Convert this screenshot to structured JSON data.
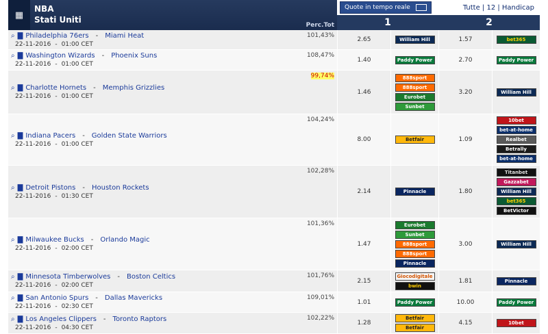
{
  "header": {
    "league": "NBA",
    "country": "Stati Uniti",
    "perc_label": "Perc.Tot",
    "quote_button": "Quote in tempo reale",
    "filter_links": "Tutte | 12 | Handicap",
    "col1": "1",
    "col2": "2"
  },
  "bookmaker_colors": {
    "William Hill": [
      "#0c2a55",
      "#ffffff"
    ],
    "Paddy Power": [
      "#0a7a3c",
      "#ffffff"
    ],
    "bet365": [
      "#0b5a33",
      "#ffd200"
    ],
    "888sport": [
      "#ff6a00",
      "#ffffff"
    ],
    "Eurobet": [
      "#1b7a2e",
      "#ffffff"
    ],
    "Sunbet": [
      "#2e9a3a",
      "#ffffff"
    ],
    "Betfair": [
      "#ffb80c",
      "#222222"
    ],
    "10bet": [
      "#c0151a",
      "#ffffff"
    ],
    "bet-at-home": [
      "#0b2f6b",
      "#ffffff"
    ],
    "Realbet": [
      "#5a5a5a",
      "#ffffff"
    ],
    "Betrally": [
      "#1a1a1a",
      "#ffffff"
    ],
    "Pinnacle": [
      "#0a2660",
      "#ffffff"
    ],
    "Titanbet": [
      "#111111",
      "#e0e0e0"
    ],
    "Gazzabet": [
      "#c2185b",
      "#ffffff"
    ],
    "BetVictor": [
      "#111111",
      "#ffffff"
    ],
    "Giocodigitale": [
      "#f5f5f5",
      "#d35400"
    ],
    "bwin": [
      "#111111",
      "#ffcc00"
    ]
  },
  "rows": [
    {
      "home": "Philadelphia 76ers",
      "away": "Miami Heat",
      "date": "22-11-2016",
      "time": "01:00 CET",
      "pct": "101,43%",
      "odd1": "2.65",
      "bk1": [
        "William Hill"
      ],
      "odd2": "1.57",
      "bk2": [
        "bet365"
      ],
      "h": 29
    },
    {
      "home": "Washington Wizards",
      "away": "Phoenix Suns",
      "date": "22-11-2016",
      "time": "01:00 CET",
      "pct": "108,47%",
      "odd1": "1.40",
      "bk1": [
        "Paddy Power"
      ],
      "odd2": "2.70",
      "bk2": [
        "Paddy Power"
      ],
      "h": 30
    },
    {
      "home": "Charlotte Hornets",
      "away": "Memphis Grizzlies",
      "date": "22-11-2016",
      "time": "01:00 CET",
      "pct": "99,74%",
      "hl": true,
      "odd1": "1.46",
      "bk1": [
        "888sport",
        "888sport",
        "Eurobet",
        "Sunbet"
      ],
      "odd2": "3.20",
      "bk2": [
        "William Hill"
      ],
      "h": 64
    },
    {
      "home": "Indiana Pacers",
      "away": "Golden State Warriors",
      "date": "22-11-2016",
      "time": "01:00 CET",
      "pct": "104,24%",
      "odd1": "8.00",
      "bk1": [
        "Betfair"
      ],
      "odd2": "1.09",
      "bk2": [
        "10bet",
        "bet-at-home",
        "Realbet",
        "Betrally",
        "bet-at-home"
      ],
      "h": 75
    },
    {
      "home": "Detroit Pistons",
      "away": "Houston Rockets",
      "date": "22-11-2016",
      "time": "01:30 CET",
      "pct": "102,28%",
      "odd1": "2.14",
      "bk1": [
        "Pinnacle"
      ],
      "odd2": "1.80",
      "bk2": [
        "Titanbet",
        "Gazzabet",
        "William Hill",
        "bet365",
        "BetVictor"
      ],
      "h": 77
    },
    {
      "home": "Milwaukee Bucks",
      "away": "Orlando Magic",
      "date": "22-11-2016",
      "time": "02:00 CET",
      "pct": "101,36%",
      "odd1": "1.47",
      "bk1": [
        "Eurobet",
        "Sunbet",
        "888sport",
        "888sport",
        "Pinnacle"
      ],
      "odd2": "3.00",
      "bk2": [
        "William Hill"
      ],
      "h": 76
    },
    {
      "home": "Minnesota Timberwolves",
      "away": "Boston Celtics",
      "date": "22-11-2016",
      "time": "02:00 CET",
      "pct": "101,76%",
      "odd1": "2.15",
      "bk1": [
        "Giocodigitale",
        "bwin"
      ],
      "odd2": "1.81",
      "bk2": [
        "Pinnacle"
      ],
      "h": 32
    },
    {
      "home": "San Antonio Spurs",
      "away": "Dallas Mavericks",
      "date": "22-11-2016",
      "time": "02:30 CET",
      "pct": "109,01%",
      "odd1": "1.01",
      "bk1": [
        "Paddy Power"
      ],
      "odd2": "10.00",
      "bk2": [
        "Paddy Power"
      ],
      "h": 30
    },
    {
      "home": "Los Angeles Clippers",
      "away": "Toronto Raptors",
      "date": "22-11-2016",
      "time": "04:30 CET",
      "pct": "102,22%",
      "odd1": "1.28",
      "bk1": [
        "Betfair",
        "Betfair"
      ],
      "odd2": "4.15",
      "bk2": [
        "10bet"
      ],
      "h": 31
    }
  ]
}
